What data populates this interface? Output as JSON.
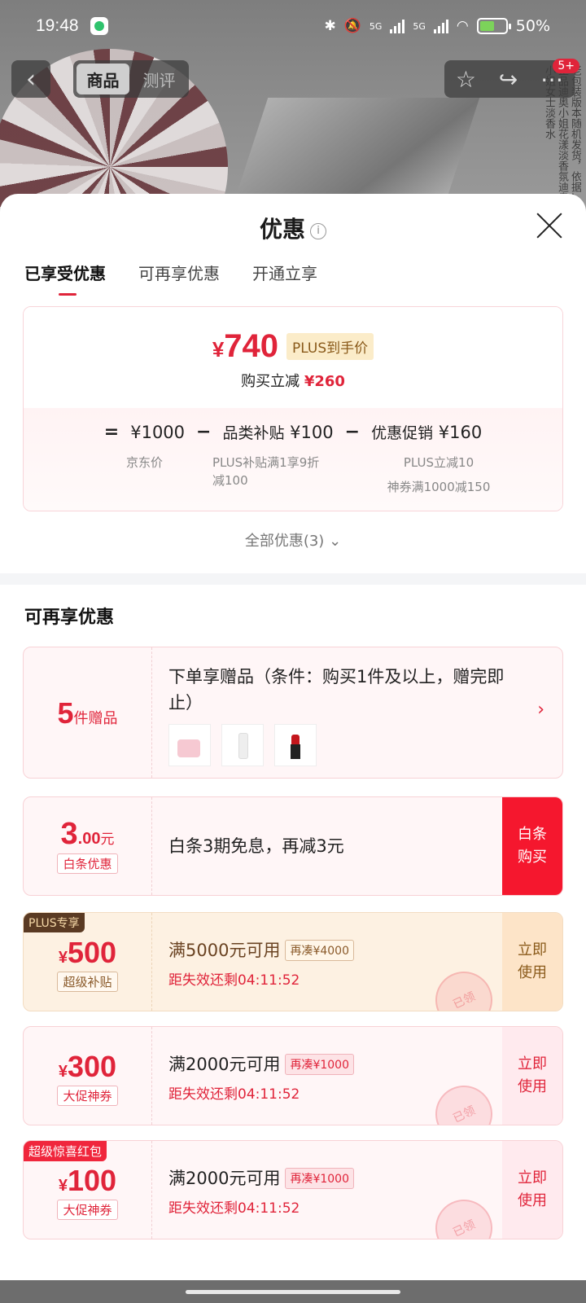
{
  "status_bar": {
    "time": "19:48",
    "net1": "5G",
    "net2": "5G",
    "battery": "50%"
  },
  "top_nav": {
    "tab_goods": "商品",
    "tab_review": "测评",
    "badge": "5+"
  },
  "bg_vertical_text": "老包装版本随机发货，依据…正品迪奥小姐花漾淡香氛迪奥小姐女士淡香水",
  "sheet": {
    "title": "优惠",
    "info": "i",
    "tabs": [
      "已享受优惠",
      "可再享优惠",
      "开通立享"
    ]
  },
  "summary": {
    "price_symbol": "¥",
    "price": "740",
    "plus_label": "PLUS到手价",
    "reduce_label": "购买立减",
    "reduce_amount": "¥260",
    "eq": "=",
    "jd_price": "¥1000",
    "minus1": "−",
    "category_label": "品类补贴",
    "category_amount": "¥100",
    "minus2": "−",
    "promo_label": "优惠促销",
    "promo_amount": "¥160",
    "jd_price_note": "京东价",
    "category_note": "PLUS补贴满1享9折减100",
    "promo_note1": "PLUS立减10",
    "promo_note2": "神券满1000减150"
  },
  "all_offers": "全部优惠(3)",
  "section_title": "可再享优惠",
  "gift_card": {
    "count": "5",
    "unit": "件赠品",
    "text": "下单享赠品（条件：购买1件及以上，赠完即止）"
  },
  "baitiao_card": {
    "amount": "3",
    "decimal": ".00",
    "unit": "元",
    "tag": "白条优惠",
    "text": "白条3期免息，再减3元",
    "action": "白条购买"
  },
  "coupons": [
    {
      "corner": "PLUS专享",
      "symbol": "¥",
      "amount": "500",
      "tag": "超级补贴",
      "condition": "满5000元可用",
      "chip": "再凑¥4000",
      "timer": "距失效还剩04:11:52",
      "action": "立即使用",
      "stamp": "已领"
    },
    {
      "corner": "",
      "symbol": "¥",
      "amount": "300",
      "tag": "大促神券",
      "condition": "满2000元可用",
      "chip": "再凑¥1000",
      "timer": "距失效还剩04:11:52",
      "action": "立即使用",
      "stamp": "已领"
    },
    {
      "corner": "超级惊喜红包",
      "symbol": "¥",
      "amount": "100",
      "tag": "大促神券",
      "condition": "满2000元可用",
      "chip": "再凑¥1000",
      "timer": "距失效还剩04:11:52",
      "action": "立即使用",
      "stamp": "已领"
    }
  ],
  "colors": {
    "accent": "#e0243a",
    "plus_gold": "#8a5a1a",
    "coupon_bg": "#fff6f7",
    "plus_bg": "#fdf1e2"
  }
}
